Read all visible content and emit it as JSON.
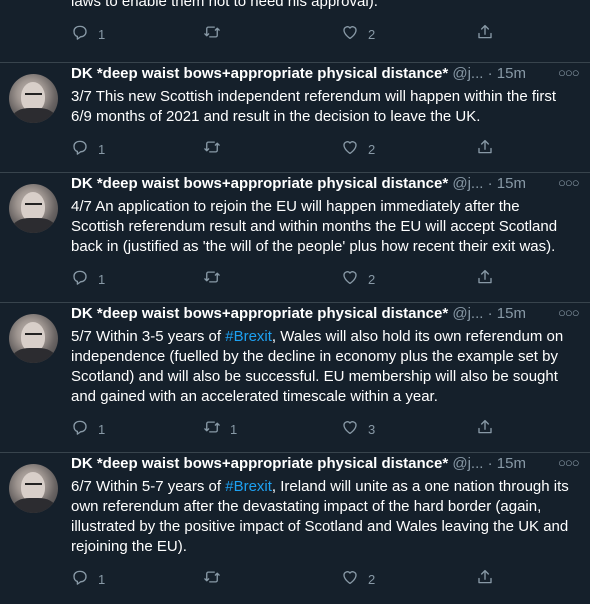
{
  "partial_tweet": {
    "text": "laws to enable them not to need his approval).",
    "reply_count": "1",
    "retweet_count": "",
    "like_count": "2"
  },
  "tweets": [
    {
      "name": "DK *deep waist bows+appropriate physical distance*",
      "handle": "@j...",
      "dot": "·",
      "time": "15m",
      "segments": [
        {
          "text": "3/7 This new Scottish independent referendum will happen within the first 6/9 months of 2021 and result in the decision to leave the UK.",
          "hashtag": false
        }
      ],
      "reply_count": "1",
      "retweet_count": "",
      "like_count": "2"
    },
    {
      "name": "DK *deep waist bows+appropriate physical distance*",
      "handle": "@j...",
      "dot": "·",
      "time": "15m",
      "segments": [
        {
          "text": "4/7 An application to rejoin the EU will happen immediately after the Scottish referendum result and within months the EU will accept Scotland back in (justified as 'the will of the people' plus how recent their exit was).",
          "hashtag": false
        }
      ],
      "reply_count": "1",
      "retweet_count": "",
      "like_count": "2"
    },
    {
      "name": "DK *deep waist bows+appropriate physical distance*",
      "handle": "@j...",
      "dot": "·",
      "time": "15m",
      "segments": [
        {
          "text": "5/7 Within 3-5 years of ",
          "hashtag": false
        },
        {
          "text": "#Brexit",
          "hashtag": true
        },
        {
          "text": ", Wales will also hold its own referendum on independence (fuelled by the decline in economy plus the example set by Scotland) and will also be successful. EU membership will also be sought and gained with an accelerated timescale within a year.",
          "hashtag": false
        }
      ],
      "reply_count": "1",
      "retweet_count": "1",
      "like_count": "3"
    },
    {
      "name": "DK *deep waist bows+appropriate physical distance*",
      "handle": "@j...",
      "dot": "·",
      "time": "15m",
      "segments": [
        {
          "text": "6/7 Within 5-7 years of ",
          "hashtag": false
        },
        {
          "text": "#Brexit",
          "hashtag": true
        },
        {
          "text": ", Ireland will unite as a one nation through its own referendum after the devastating impact of the hard border (again, illustrated by the positive impact of Scotland and Wales leaving the UK and rejoining the EU).",
          "hashtag": false
        }
      ],
      "reply_count": "1",
      "retweet_count": "",
      "like_count": "2"
    }
  ],
  "icons": {
    "reply": "reply-icon",
    "retweet": "retweet-icon",
    "like": "heart-icon",
    "share": "share-icon",
    "more": "more-icon"
  },
  "colors": {
    "background": "#15202b",
    "text": "#ffffff",
    "secondary": "#8899a6",
    "hashtag": "#1da1f2",
    "divider": "#38444d"
  }
}
